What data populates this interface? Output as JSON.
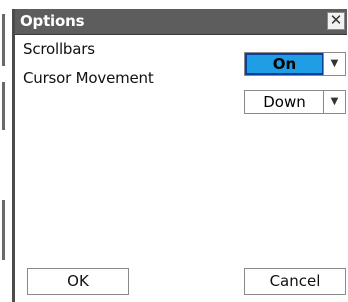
{
  "dialog": {
    "title": "Options",
    "close_icon": "close-icon",
    "close_glyph": "✕"
  },
  "settings": [
    {
      "label": "Scrollbars",
      "value": "On",
      "highlighted": true
    },
    {
      "label": "Cursor Movement",
      "value": "Down",
      "highlighted": false
    }
  ],
  "dropdown_icon": "triangle-down-icon",
  "dropdown_glyph": "▼",
  "buttons": {
    "ok": "OK",
    "cancel": "Cancel"
  },
  "colors": {
    "titlebar": "#5d5d5d",
    "highlight": "#1f9ee6",
    "highlight_border": "#0a3f9c"
  }
}
